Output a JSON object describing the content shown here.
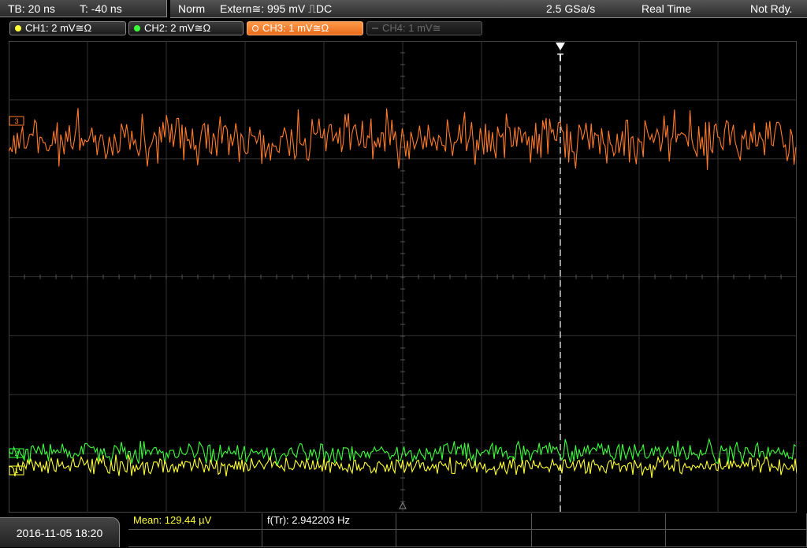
{
  "timebase": {
    "tb": "TB: 20 ns",
    "offset": "T: -40 ns"
  },
  "status": {
    "mode": "Norm",
    "trigger": "Extern≅: 995 mV ⎍DC",
    "sample_rate": "2.5 GSa/s",
    "acquisition": "Real Time",
    "state": "Not Rdy."
  },
  "channels": [
    {
      "label": "CH1: 2 mV≅Ω",
      "color": "#ffff3a",
      "state": "on"
    },
    {
      "label": "CH2: 2 mV≅Ω",
      "color": "#3cff3c",
      "state": "on"
    },
    {
      "label": "CH3: 1 mV≅Ω",
      "color": "#ff7a2a",
      "state": "active"
    },
    {
      "label": "CH4: 1 mV≅",
      "color": "#6a6a6a",
      "state": "off"
    }
  ],
  "markers": {
    "trigger": "T",
    "ch3": "3",
    "ch2": "2",
    "ch1": "1"
  },
  "datetime": "2016-11-05 18:20",
  "measurements": {
    "mean": "Mean: 129.44 µV",
    "freq": "f(Tr): 2.942203 Hz"
  },
  "colors": {
    "ch1": "#ffff3a",
    "ch2": "#3cff3c",
    "ch3": "#ff7a2a",
    "grid": "#3a3a3a",
    "cursor": "#ffffff"
  }
}
